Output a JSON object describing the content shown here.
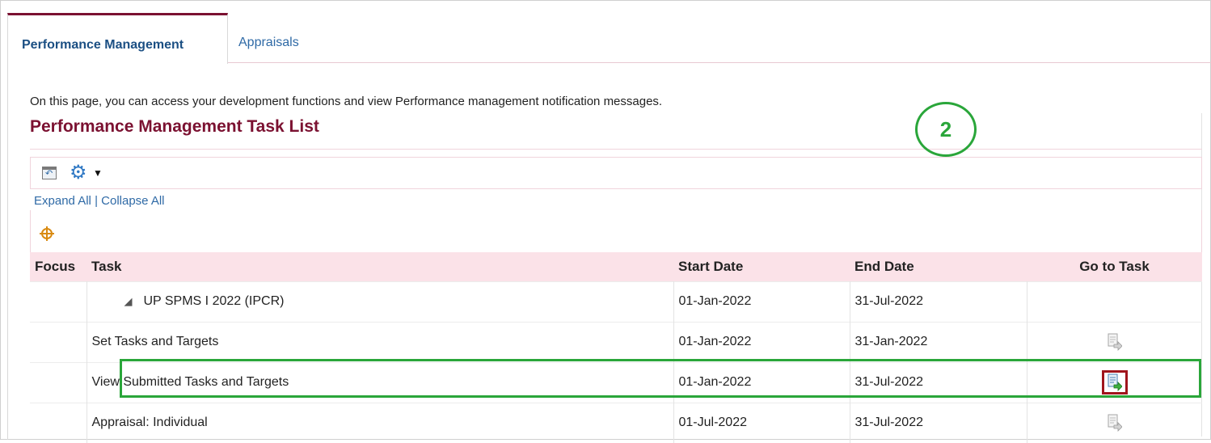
{
  "tabs": [
    {
      "label": "Performance Management",
      "active": true
    },
    {
      "label": "Appraisals",
      "active": false
    }
  ],
  "intro_text": "On this page, you can access your development functions and view Performance management notification messages.",
  "page_title": "Performance Management Task List",
  "annotation_badge": "2",
  "toolbar": {
    "detach_icon": "detach-icon",
    "settings_icon": "gear-icon",
    "menu_caret_icon": "caret-down-icon"
  },
  "expand_all": "Expand All",
  "separator": "|",
  "collapse_all": "Collapse All",
  "focus_icon": "focus-crosshair-icon",
  "table": {
    "headers": {
      "focus": "Focus",
      "task": "Task",
      "start": "Start Date",
      "end": "End Date",
      "go": "Go to Task"
    },
    "rows": [
      {
        "task": "UP SPMS I 2022 (IPCR)",
        "start": "01-Jan-2022",
        "end": "31-Jul-2022",
        "has_go": false,
        "is_parent": true,
        "tree_icon": "collapse-triangle-icon"
      },
      {
        "task": "Set Tasks and Targets",
        "start": "01-Jan-2022",
        "end": "31-Jan-2022",
        "has_go": true,
        "is_parent": false,
        "go_state": "disabled"
      },
      {
        "task": "View Submitted Tasks and Targets",
        "start": "01-Jan-2022",
        "end": "31-Jul-2022",
        "has_go": true,
        "is_parent": false,
        "go_state": "enabled",
        "highlighted": true
      },
      {
        "task": "Appraisal: Individual",
        "start": "01-Jul-2022",
        "end": "31-Jul-2022",
        "has_go": true,
        "is_parent": false,
        "go_state": "disabled"
      }
    ]
  },
  "colors": {
    "title": "#7b1131",
    "link": "#2f6aa6",
    "header_bg": "#fbe2e8",
    "highlight": "#2aa63a",
    "selected_border": "#a0151c"
  }
}
